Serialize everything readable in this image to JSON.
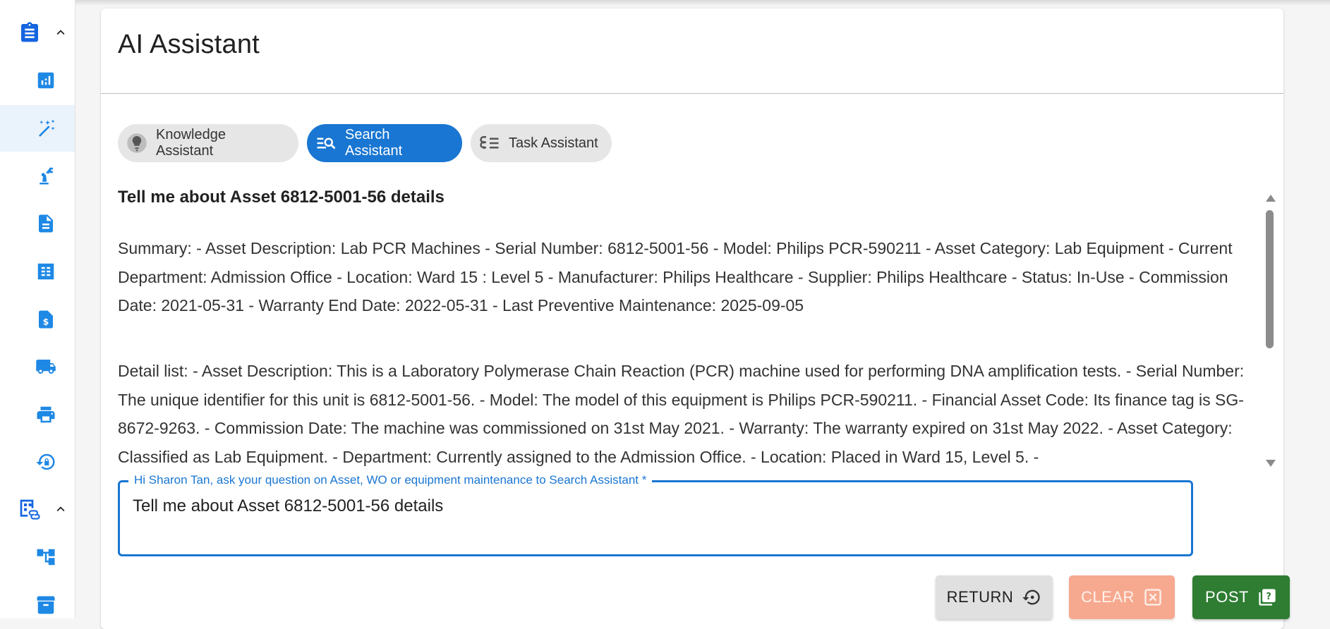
{
  "page": {
    "title": "AI Assistant"
  },
  "colors": {
    "accent": "#1976d2",
    "sidebar_icon": "#1e88e5",
    "post": "#2e7d32",
    "clear": "#f7a98f",
    "return": "#e0e0e0"
  },
  "sidebar": {
    "groups": [
      {
        "icon": "clipboard-icon",
        "expanded": true
      },
      {
        "icon": "building-link-icon",
        "expanded": true
      }
    ],
    "items": [
      {
        "icon": "bar-chart-icon"
      },
      {
        "icon": "magic-wand-icon",
        "active": true
      },
      {
        "icon": "robot-arm-icon"
      },
      {
        "icon": "document-icon"
      },
      {
        "icon": "list-icon"
      },
      {
        "icon": "invoice-dollar-icon"
      },
      {
        "icon": "truck-icon"
      },
      {
        "icon": "printer-icon"
      },
      {
        "icon": "lock-history-icon"
      },
      {
        "icon": "hierarchy-icon"
      },
      {
        "icon": "archive-icon"
      }
    ]
  },
  "tabs": [
    {
      "label": "Knowledge Assistant",
      "icon": "lightbulb-icon",
      "active": false
    },
    {
      "label": "Search Assistant",
      "icon": "search-list-icon",
      "active": true
    },
    {
      "label": "Task Assistant",
      "icon": "task-list-icon",
      "active": false
    }
  ],
  "conversation": {
    "question": "Tell me about Asset 6812-5001-56 details",
    "summary": "Summary: - Asset Description: Lab PCR Machines - Serial Number: 6812-5001-56 - Model: Philips PCR-590211 - Asset Category: Lab Equipment - Current Department: Admission Office - Location: Ward 15 : Level 5 - Manufacturer: Philips Healthcare - Supplier: Philips Healthcare - Status: In-Use - Commission Date: 2021-05-31 - Warranty End Date: 2022-05-31 - Last Preventive Maintenance: 2025-09-05",
    "detail": "Detail list: - Asset Description: This is a Laboratory Polymerase Chain Reaction (PCR) machine used for performing DNA amplification tests. - Serial Number: The unique identifier for this unit is 6812-5001-56. - Model: The model of this equipment is Philips PCR-590211. - Financial Asset Code: Its finance tag is SG-8672-9263. - Commission Date: The machine was commissioned on 31st May 2021. - Warranty: The warranty expired on 31st May 2022. - Asset Category: Classified as Lab Equipment. - Department: Currently assigned to the Admission Office. - Location: Placed in Ward 15, Level 5. -"
  },
  "input": {
    "label": "Hi Sharon Tan, ask your question on Asset, WO or equipment maintenance to Search Assistant *",
    "value": "Tell me about Asset 6812-5001-56 details"
  },
  "buttons": {
    "return": "RETURN",
    "clear": "CLEAR",
    "post": "POST"
  }
}
